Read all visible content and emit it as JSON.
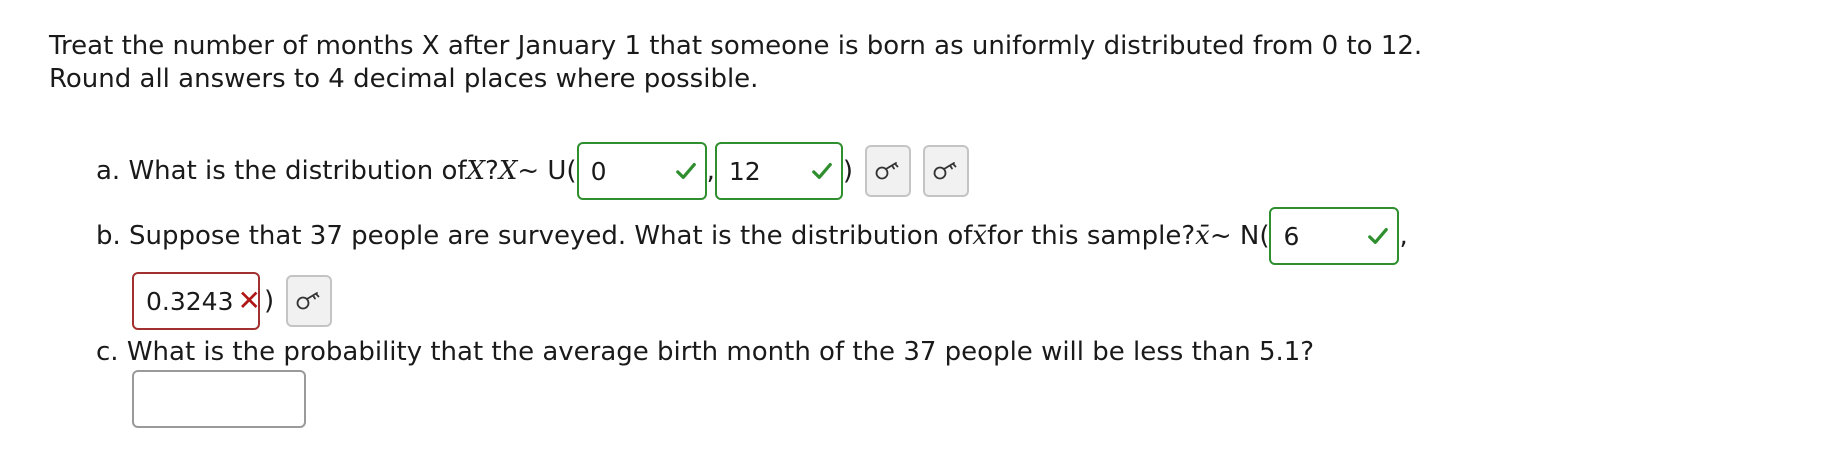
{
  "intro": {
    "line1": "Treat the number of months X after January 1 that someone is born as uniformly distributed from 0 to 12.",
    "line2": "Round all answers to 4 decimal places where possible."
  },
  "part_a": {
    "label": "a. What is the distribution of ",
    "var": "X",
    "q": "? ",
    "var2": "X",
    "tilde": " ~ U(",
    "sep": ",",
    "close": ")",
    "answer1": "0",
    "answer1_status": "correct",
    "answer2": "12",
    "answer2_status": "correct"
  },
  "part_b": {
    "label": "b. Suppose that 37 people are surveyed.  What is the distribution of ",
    "var": "x̄",
    "mid": " for this sample? ",
    "var2": "x̄",
    "tilde": " ~ N(",
    "sep": ",",
    "close": ")",
    "answer1": "6",
    "answer1_status": "correct",
    "answer2": "0.3243",
    "answer2_status": "wrong"
  },
  "part_c": {
    "label": "c. What is the probability that the average birth month of the 37 people will be less than 5.1?",
    "answer": ""
  },
  "icons": {
    "check": "check-icon",
    "wrong": "x-mark-icon",
    "key": "key-icon"
  },
  "colors": {
    "correct": "#2f8f2f",
    "wrong": "#b01818",
    "button_bg": "#f1f1f1"
  }
}
